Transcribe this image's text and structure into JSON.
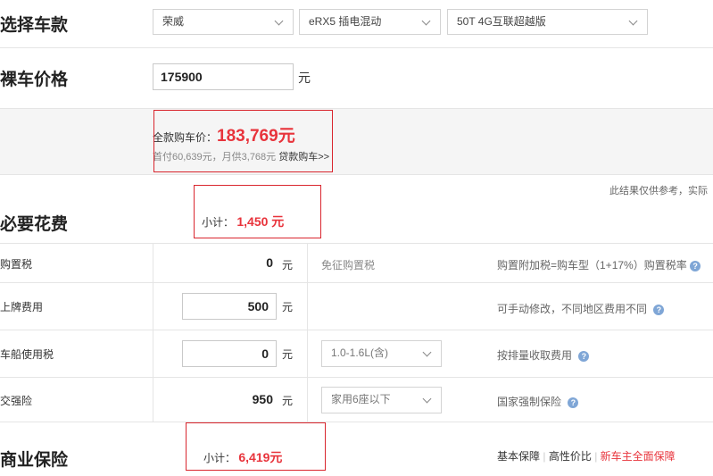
{
  "car_select": {
    "title": "选择车款",
    "brand": "荣威",
    "series": "eRX5 插电混动",
    "model": "50T 4G互联超越版"
  },
  "price": {
    "title": "裸车价格",
    "value": "175900",
    "unit": "元"
  },
  "summary": {
    "full_label": "全款购车价：",
    "full_value": "183,769元",
    "loan_text": "首付60,639元，月供3,768元",
    "loan_link": "贷款购车>>"
  },
  "disclaimer": "此结果仅供参考，实际",
  "necessary": {
    "title": "必要花费",
    "subtotal_label": "小计：",
    "subtotal_value": "1,450 元",
    "rows": [
      {
        "label": "购置税",
        "value": "0",
        "unit": "元",
        "option": "免征购置税",
        "note": "购置附加税=购车型（1+17%）购置税率"
      },
      {
        "label": "上牌费用",
        "value": "500",
        "unit": "元",
        "option": "",
        "note": "可手动修改，不同地区费用不同"
      },
      {
        "label": "车船使用税",
        "value": "0",
        "unit": "元",
        "option": "1.0-1.6L(含)",
        "note": "按排量收取费用"
      },
      {
        "label": "交强险",
        "value": "950",
        "unit": "元",
        "option": "家用6座以下",
        "note": "国家强制保险"
      }
    ]
  },
  "commercial": {
    "title": "商业保险",
    "subtotal_label": "小计：",
    "subtotal_value": "6,419元",
    "tab_basic": "基本保障",
    "tab_value": "高性价比",
    "tab_full": "新车主全面保障"
  },
  "icons": {
    "help": "help-icon",
    "dropdown": "chevron-down-icon"
  },
  "colors": {
    "accent_red": "#e8333b",
    "help_blue": "#7fa6d6"
  }
}
